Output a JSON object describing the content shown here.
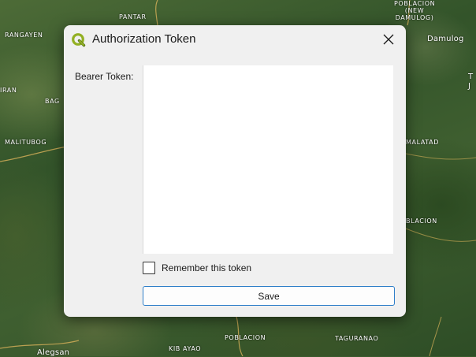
{
  "map": {
    "places": {
      "pantar": "PANTAR",
      "rangayen": "RANGAYEN",
      "poblacion_new_damulog": "POBLACION (NEW DAMULOG)",
      "damulog": "Damulog",
      "iran": "IRAN",
      "bag": "BAG",
      "malitubog": "MALITUBOG",
      "malatad": "MALATAD",
      "blacion": "BLACION",
      "kibayao": "KIB AYAO",
      "poblacion": "POBLACION",
      "taguranao": "TAGURANAO",
      "alegsan": "Alegsan",
      "edge_t": "T",
      "edge_j": "J"
    }
  },
  "dialog": {
    "title": "Authorization Token",
    "icon": "qgis-logo-icon",
    "bearer_label": "Bearer Token:",
    "token_value": "",
    "remember_label": "Remember this token",
    "remember_checked": false,
    "save_label": "Save"
  },
  "colors": {
    "accent": "#2f7fc9",
    "qgis_green": "#93b023",
    "dialog_bg": "#f0f0f0"
  }
}
